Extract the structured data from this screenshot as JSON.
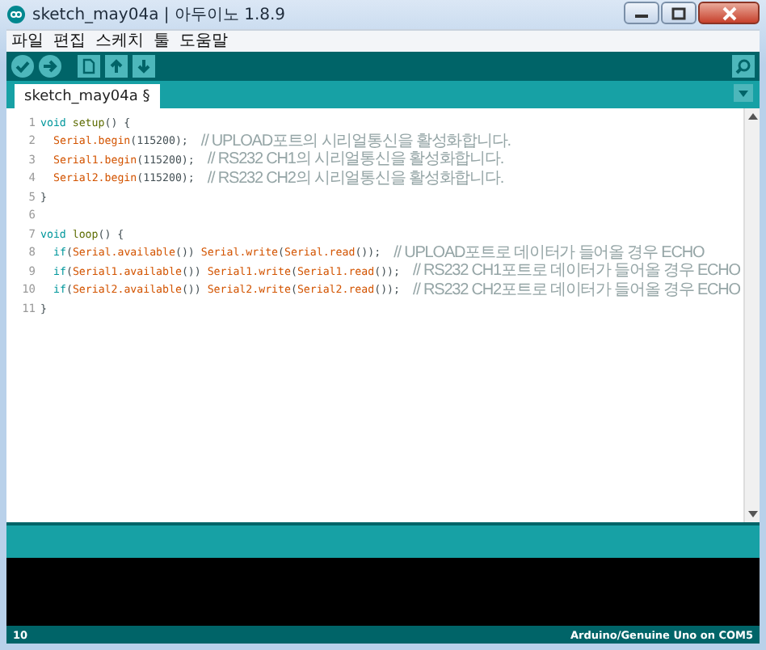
{
  "window": {
    "title": "sketch_may04a | 아두이노 1.8.9"
  },
  "menu": [
    {
      "label": "파일"
    },
    {
      "label": "편집"
    },
    {
      "label": "스케치"
    },
    {
      "label": "툴"
    },
    {
      "label": "도움말"
    }
  ],
  "tabs": [
    {
      "label": "sketch_may04a §",
      "selected": true
    }
  ],
  "editor": {
    "lines": [
      {
        "number": "1",
        "indented": false,
        "tokens": [
          {
            "kind": "keyword",
            "text": "void "
          },
          {
            "kind": "function2",
            "text": "setup"
          },
          {
            "kind": "plain",
            "text": "() {"
          }
        ]
      },
      {
        "number": "2",
        "indented": true,
        "tokens": [
          {
            "kind": "class",
            "text": "Serial"
          },
          {
            "kind": "function",
            "text": ".begin"
          },
          {
            "kind": "plain",
            "text": "(115200);"
          }
        ],
        "comment": "// UPLOAD포트의 시리얼통신을 활성화합니다."
      },
      {
        "number": "3",
        "indented": true,
        "tokens": [
          {
            "kind": "class",
            "text": "Serial1"
          },
          {
            "kind": "function",
            "text": ".begin"
          },
          {
            "kind": "plain",
            "text": "(115200);"
          }
        ],
        "comment": "// RS232 CH1의 시리얼통신을 활성화합니다."
      },
      {
        "number": "4",
        "indented": true,
        "tokens": [
          {
            "kind": "class",
            "text": "Serial2"
          },
          {
            "kind": "function",
            "text": ".begin"
          },
          {
            "kind": "plain",
            "text": "(115200);"
          }
        ],
        "comment": "// RS232 CH2의 시리얼통신을 활성화합니다."
      },
      {
        "number": "5",
        "indented": false,
        "tokens": [
          {
            "kind": "plain",
            "text": "}"
          }
        ]
      },
      {
        "number": "6"
      },
      {
        "number": "7",
        "indented": false,
        "tokens": [
          {
            "kind": "keyword",
            "text": "void "
          },
          {
            "kind": "function2",
            "text": "loop"
          },
          {
            "kind": "plain",
            "text": "() {"
          }
        ]
      },
      {
        "number": "8",
        "indented": true,
        "tokens": [
          {
            "kind": "keyword",
            "text": "if"
          },
          {
            "kind": "plain",
            "text": "("
          },
          {
            "kind": "class",
            "text": "Serial"
          },
          {
            "kind": "function",
            "text": ".available"
          },
          {
            "kind": "plain",
            "text": "()) "
          },
          {
            "kind": "class",
            "text": "Serial"
          },
          {
            "kind": "function",
            "text": ".write"
          },
          {
            "kind": "plain",
            "text": "("
          },
          {
            "kind": "class",
            "text": "Serial"
          },
          {
            "kind": "function",
            "text": ".read"
          },
          {
            "kind": "plain",
            "text": "());"
          }
        ],
        "comment": "// UPLOAD포트로 데이터가 들어올 경우 ECHO"
      },
      {
        "number": "9",
        "indented": true,
        "tokens": [
          {
            "kind": "keyword",
            "text": "if"
          },
          {
            "kind": "plain",
            "text": "("
          },
          {
            "kind": "class",
            "text": "Serial1"
          },
          {
            "kind": "function",
            "text": ".available"
          },
          {
            "kind": "plain",
            "text": "()) "
          },
          {
            "kind": "class",
            "text": "Serial1"
          },
          {
            "kind": "function",
            "text": ".write"
          },
          {
            "kind": "plain",
            "text": "("
          },
          {
            "kind": "class",
            "text": "Serial1"
          },
          {
            "kind": "function",
            "text": ".read"
          },
          {
            "kind": "plain",
            "text": "());"
          }
        ],
        "comment": "// RS232 CH1포트로 데이터가 들어올 경우 ECHO"
      },
      {
        "number": "10",
        "indented": true,
        "tokens": [
          {
            "kind": "keyword",
            "text": "if"
          },
          {
            "kind": "plain",
            "text": "("
          },
          {
            "kind": "class",
            "text": "Serial2"
          },
          {
            "kind": "function",
            "text": ".available"
          },
          {
            "kind": "plain",
            "text": "()) "
          },
          {
            "kind": "class",
            "text": "Serial2"
          },
          {
            "kind": "function",
            "text": ".write"
          },
          {
            "kind": "plain",
            "text": "("
          },
          {
            "kind": "class",
            "text": "Serial2"
          },
          {
            "kind": "function",
            "text": ".read"
          },
          {
            "kind": "plain",
            "text": "());"
          }
        ],
        "comment": "// RS232 CH2포트로 데이터가 들어올 경우 ECHO"
      },
      {
        "number": "11",
        "indented": false,
        "tokens": [
          {
            "kind": "plain",
            "text": "}"
          }
        ]
      }
    ]
  },
  "status_bar": {
    "line": "10",
    "board": "Arduino/Genuine Uno on COM5"
  }
}
